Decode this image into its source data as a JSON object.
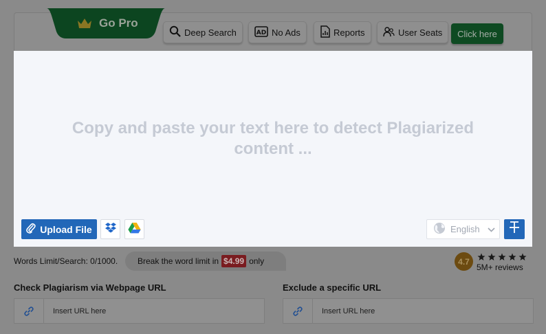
{
  "header": {
    "go_pro_label": "Go Pro",
    "features": [
      {
        "label": "Deep Search",
        "icon": "search-icon"
      },
      {
        "label": "No Ads",
        "icon": "ad-block-icon"
      },
      {
        "label": "Reports",
        "icon": "report-icon"
      },
      {
        "label": "User Seats",
        "icon": "users-icon"
      }
    ],
    "cta_label": "Click here",
    "cta_color": "#0e4a22"
  },
  "editor": {
    "placeholder": "Copy and paste your text here to detect Plagiarized content ...",
    "upload_label": "Upload File",
    "language": "English",
    "accent": "#2267b8"
  },
  "limits": {
    "text": "Words Limit/Search: 0/1000.",
    "break_prefix": "Break the word limit in",
    "price": "$4.99",
    "break_suffix": "only"
  },
  "rating": {
    "score": "4.7",
    "stars": 5,
    "reviews": "5M+ reviews"
  },
  "url_check": {
    "label": "Check Plagiarism via Webpage URL",
    "placeholder": "Insert URL here"
  },
  "url_exclude": {
    "label": "Exclude a specific URL",
    "placeholder": "Insert URL here"
  }
}
